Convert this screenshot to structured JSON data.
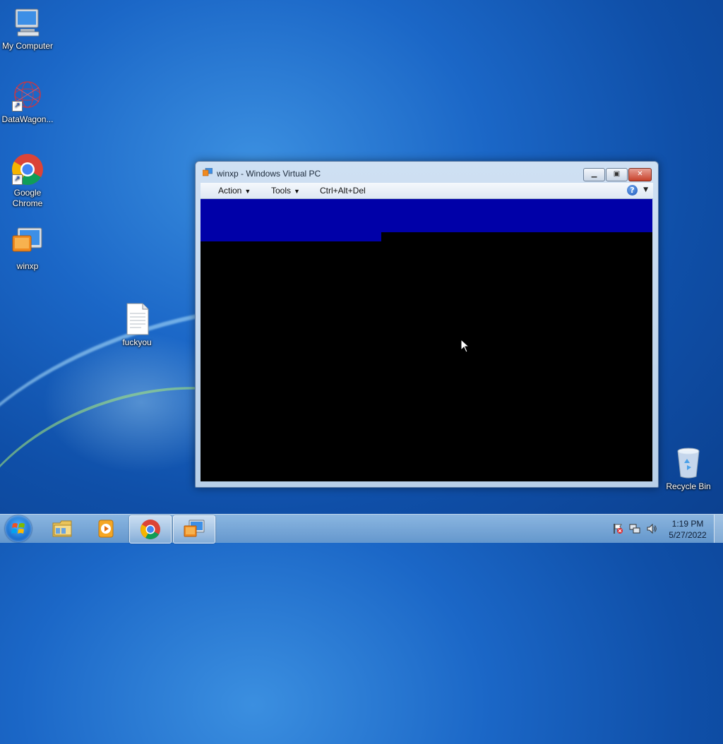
{
  "desktop": {
    "icons": [
      {
        "label": "My Computer",
        "icon": "computer-icon"
      },
      {
        "label": "DataWagon...",
        "icon": "network-sphere-icon"
      },
      {
        "label": "Google Chrome",
        "icon": "chrome-icon"
      },
      {
        "label": "winxp",
        "icon": "virtual-pc-icon"
      },
      {
        "label": "fuckyou",
        "icon": "text-file-icon"
      },
      {
        "label": "Recycle Bin",
        "icon": "recycle-bin-icon"
      }
    ]
  },
  "window": {
    "title": "winxp - Windows Virtual PC",
    "menu": {
      "action": "Action",
      "tools": "Tools",
      "cad": "Ctrl+Alt+Del"
    },
    "help_glyph": "?",
    "colors": {
      "screen_blue": "#0000a8",
      "screen_black": "#000000"
    }
  },
  "taskbar": {
    "buttons": [
      "windows-explorer",
      "windows-media-player",
      "google-chrome",
      "windows-virtual-pc"
    ],
    "active": [
      "google-chrome",
      "windows-virtual-pc"
    ],
    "clock": {
      "time": "1:19 PM",
      "date": "5/27/2022"
    }
  }
}
